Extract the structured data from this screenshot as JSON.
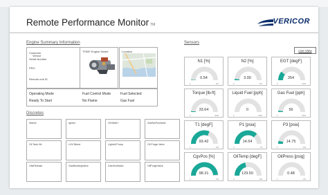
{
  "header": {
    "title": "Remote Performance Monitor",
    "title_mark": "TM",
    "logo": "VERICOR"
  },
  "engine_summary": {
    "section_title": "Engine Summary Information",
    "fields": [
      "Customer",
      "Vericor",
      "Serial Number",
      "",
      "PRG",
      "",
      "Remote unit ID"
    ],
    "model_label": "TF50F Engine Model",
    "location_label": "Location",
    "modes": [
      {
        "label": "Operating Mode",
        "value": "Ready To Start"
      },
      {
        "label": "Fuel Control Mode",
        "value": "No Flame"
      },
      {
        "label": "Fuel Selected",
        "value": "Gas Fuel"
      }
    ]
  },
  "discretes": {
    "section_title": "Discretes",
    "items": [
      "Starter",
      "Ignitor",
      "Oil Bkflo?",
      "SubBinPosValve",
      "Oil Tank Htr",
      "LHV Bleed",
      "Lightoil Pump",
      "Oil Purge Valve",
      "OilsRelease",
      "GasBlockingValve",
      "GasVentValve",
      "OilPurgeValve"
    ]
  },
  "sensors": {
    "section_title": "Sensors",
    "live_view_label": "Live View",
    "gauges": [
      {
        "label": "N1 [%]",
        "value": "0.54",
        "min": "0",
        "max": "110",
        "fraction": 0.01
      },
      {
        "label": "N2 [%]",
        "value": "3.00",
        "min": "0",
        "max": "110",
        "fraction": 0.03
      },
      {
        "label": "EGT [degF]",
        "value": "354",
        "min": "0",
        "max": "1600",
        "fraction": 0.22
      },
      {
        "label": "Torque [lb-ft]",
        "value": "33.64",
        "min": "0",
        "max": "3000",
        "fraction": 0.02
      },
      {
        "label": "Liquid Fuel [pph]",
        "value": "0",
        "min": "0",
        "max": "2000",
        "fraction": 0.0
      },
      {
        "label": "Gas Fuel [pph]",
        "value": "56",
        "min": "0",
        "max": "2000",
        "fraction": 0.03
      },
      {
        "label": "T1 [degF]",
        "value": "93.42",
        "min": "0",
        "max": "150",
        "fraction": 0.62
      },
      {
        "label": "P1 [psia]",
        "value": "14.54",
        "min": "0",
        "max": "20",
        "fraction": 0.73
      },
      {
        "label": "P3 [psia]",
        "value": "14.75",
        "min": "0",
        "max": "200",
        "fraction": 0.07
      },
      {
        "label": "CgvPos [%]",
        "value": "98.31",
        "min": "0",
        "max": "100",
        "fraction": 0.98
      },
      {
        "label": "OilTemp [degF]",
        "value": "129.50",
        "min": "0",
        "max": "300",
        "fraction": 0.43
      },
      {
        "label": "OilPress [psig]",
        "value": "0.48",
        "min": "0",
        "max": "100",
        "fraction": 0.0
      }
    ]
  },
  "colors": {
    "accent": "#1aa898",
    "track": "#e2e2e2",
    "brand": "#0b2d6b"
  }
}
